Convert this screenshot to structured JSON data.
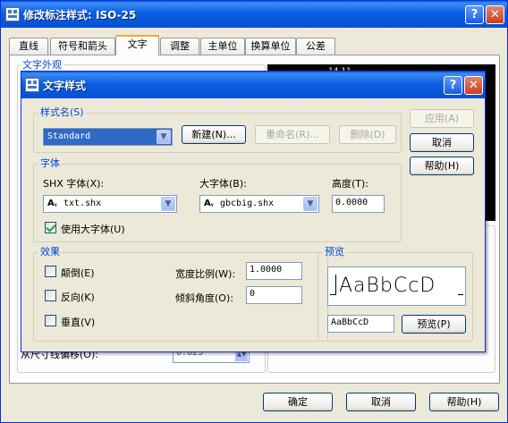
{
  "outer_window": {
    "title": "修改标注样式: ISO-25",
    "help_btn": "?",
    "close_btn": "✕"
  },
  "tabs": [
    {
      "label": "直线"
    },
    {
      "label": "符号和箭头"
    },
    {
      "label": "文字"
    },
    {
      "label": "调整"
    },
    {
      "label": "主单位"
    },
    {
      "label": "换算单位"
    },
    {
      "label": "公差"
    }
  ],
  "text_tab": {
    "appearance_group": "文字外观",
    "preview_value": "14,11",
    "offset_label": "从尺寸线偏移(O):",
    "offset_value": "0.625"
  },
  "bottom_buttons": {
    "ok": "确定",
    "cancel": "取消",
    "help": "帮助(H)"
  },
  "dialog": {
    "title": "文字样式",
    "help_btn": "?",
    "close_btn": "✕",
    "style_group": "样式名(S)",
    "style_value": "Standard",
    "new_btn": "新建(N)...",
    "rename_btn": "重命名(R)...",
    "delete_btn": "删除(D)",
    "apply_btn": "应用(A)",
    "cancel_btn": "取消",
    "help_btn_text": "帮助(H)",
    "font_group": "字体",
    "shx_label": "SHX 字体(X):",
    "shx_value": "txt.shx",
    "big_label": "大字体(B):",
    "big_value": "gbcbig.shx",
    "height_label": "高度(T):",
    "height_value": "0.0000",
    "use_big_font": "使用大字体(U)",
    "use_big_font_checked": true,
    "effects_group": "效果",
    "upside_down": "颠倒(E)",
    "backwards": "反向(K)",
    "vertical": "垂直(V)",
    "width_factor_label": "宽度比例(W):",
    "width_factor_value": "1.0000",
    "oblique_label": "倾斜角度(O):",
    "oblique_value": "0",
    "preview_group": "预览",
    "preview_sample": "AaBbCcD",
    "preview_input": "AaBbCcD",
    "preview_btn": "预览(P)"
  }
}
